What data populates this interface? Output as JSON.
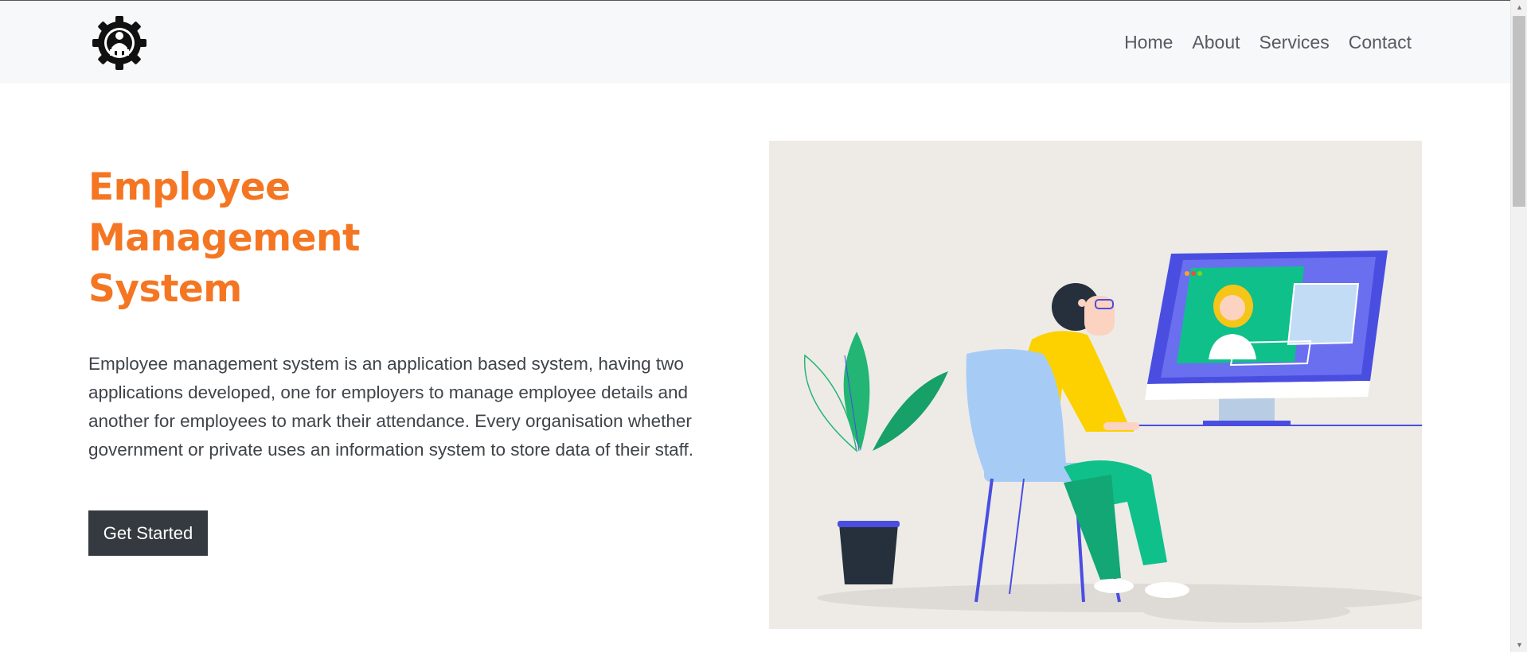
{
  "nav": {
    "logo_icon": "gear-people-logo-icon",
    "links": [
      "Home",
      "About",
      "Services",
      "Contact"
    ]
  },
  "hero": {
    "title_lines": [
      "Employee",
      "Management",
      "System"
    ],
    "description": "Employee management system is an application based system, having two applications developed, one for employers to manage employee details and another for employees to mark their attendance. Every organisation whether government or private uses an information system to store data of their staff.",
    "cta_label": "Get Started",
    "illustration_icon": "person-at-computer-video-call-illustration"
  },
  "colors": {
    "accent": "#f47622",
    "navbar_bg": "#f7f8f9",
    "button_bg": "#343a40",
    "illustration_bg": "#eeebe7"
  }
}
